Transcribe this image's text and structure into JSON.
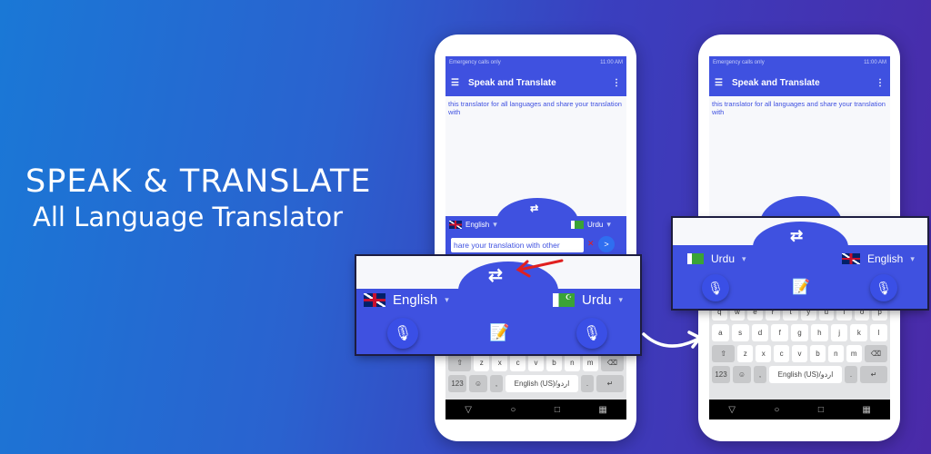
{
  "headline": {
    "title": "SPEAK & TRANSLATE",
    "subtitle": "All Language Translator"
  },
  "app": {
    "status_left": "Emergency calls only",
    "status_right": "11:00 AM",
    "title": "Speak and Translate",
    "body_text": "this translator for all languages and share your translation with"
  },
  "phone1": {
    "source_lang": "English",
    "target_lang": "Urdu",
    "input_value": "hare your translation with other",
    "clear_icon": "✕",
    "send_icon": ">"
  },
  "overlay1": {
    "source_lang": "English",
    "target_lang": "Urdu"
  },
  "overlay2": {
    "source_lang": "Urdu",
    "target_lang": "English"
  },
  "keyboard": {
    "row_q": [
      "q",
      "w",
      "e",
      "r",
      "t",
      "y",
      "u",
      "i",
      "o",
      "p"
    ],
    "row_a": [
      "a",
      "s",
      "d",
      "f",
      "g",
      "h",
      "j",
      "k",
      "l"
    ],
    "row_z": [
      "z",
      "x",
      "c",
      "v",
      "b",
      "n",
      "m"
    ],
    "num_key": "123",
    "space_label": "English (US)/اردو"
  },
  "colors": {
    "primary": "#3f51e0",
    "arrow_red": "#e02020"
  },
  "icons": [
    "swap-icon",
    "mic-icon",
    "notes-edit-icon",
    "menu-icon",
    "more-vert-icon",
    "uk-flag-icon",
    "pakistan-flag-icon"
  ]
}
